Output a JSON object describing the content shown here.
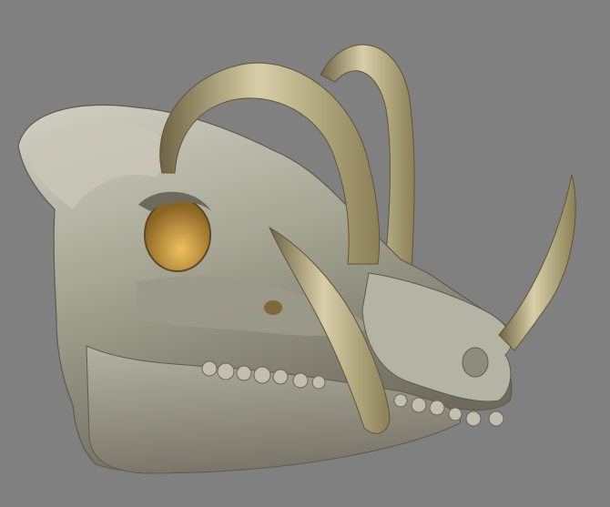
{
  "scene": {
    "background_color": "#808080",
    "subject": "babirusa-skull-render",
    "bone_color": "#a9a795",
    "bone_shadow_color": "#6e6b5e",
    "bone_highlight_color": "#d2d0c4",
    "tusk_color": "#a79a6d",
    "tusk_shadow_color": "#6e6444",
    "tusk_highlight_color": "#d8cfa8",
    "socket_color": "#d9a13c"
  }
}
